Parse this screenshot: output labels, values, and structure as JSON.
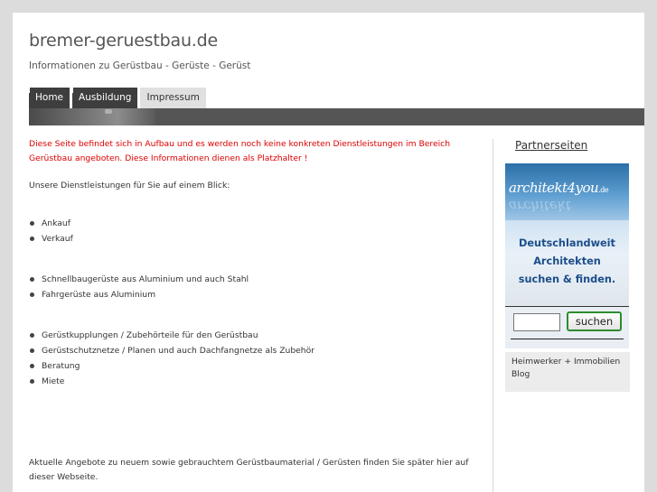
{
  "header": {
    "title": "bremer-geruestbau.de",
    "subtitle": "Informationen zu Gerüstbau - Gerüste - Gerüst"
  },
  "nav": {
    "tabs": [
      {
        "label": "Home"
      },
      {
        "label": "Ausbildung"
      },
      {
        "label": "Impressum"
      }
    ]
  },
  "content": {
    "notice": "Diese Seite befindet sich in Aufbau und es werden noch keine konkreten Dienstleistungen im Bereich Gerüstbau angeboten. Diese Informationen dienen als Platzhalter !",
    "intro": "Unsere Dienstleistungen für Sie auf einem Blick:",
    "list1": [
      "Ankauf",
      "Verkauf"
    ],
    "list2": [
      "Schnellbaugerüste aus Aluminium und auch Stahl",
      "Fahrgerüste aus Aluminium"
    ],
    "list3": [
      "Gerüstkupplungen / Zubehörteile für den Gerüstbau",
      "Gerüstschutznetze / Planen und auch Dachfangnetze als Zubehör",
      "Beratung",
      "Miete"
    ],
    "footer_text": "Aktuelle Angebote zu neuem sowie gebrauchtem Gerüstbaumaterial / Gerüsten finden Sie später hier auf dieser Webseite."
  },
  "sidebar": {
    "title": "Partnerseiten",
    "ad": {
      "logo_main": "architekt",
      "logo_num": "4",
      "logo_tail": "you",
      "logo_tld": ".de",
      "line1": "Deutschlandweit",
      "line2": "Architekten",
      "line3": "suchen & finden.",
      "button_label": "suchen"
    },
    "link": "Heimwerker + Immobilien Blog"
  }
}
